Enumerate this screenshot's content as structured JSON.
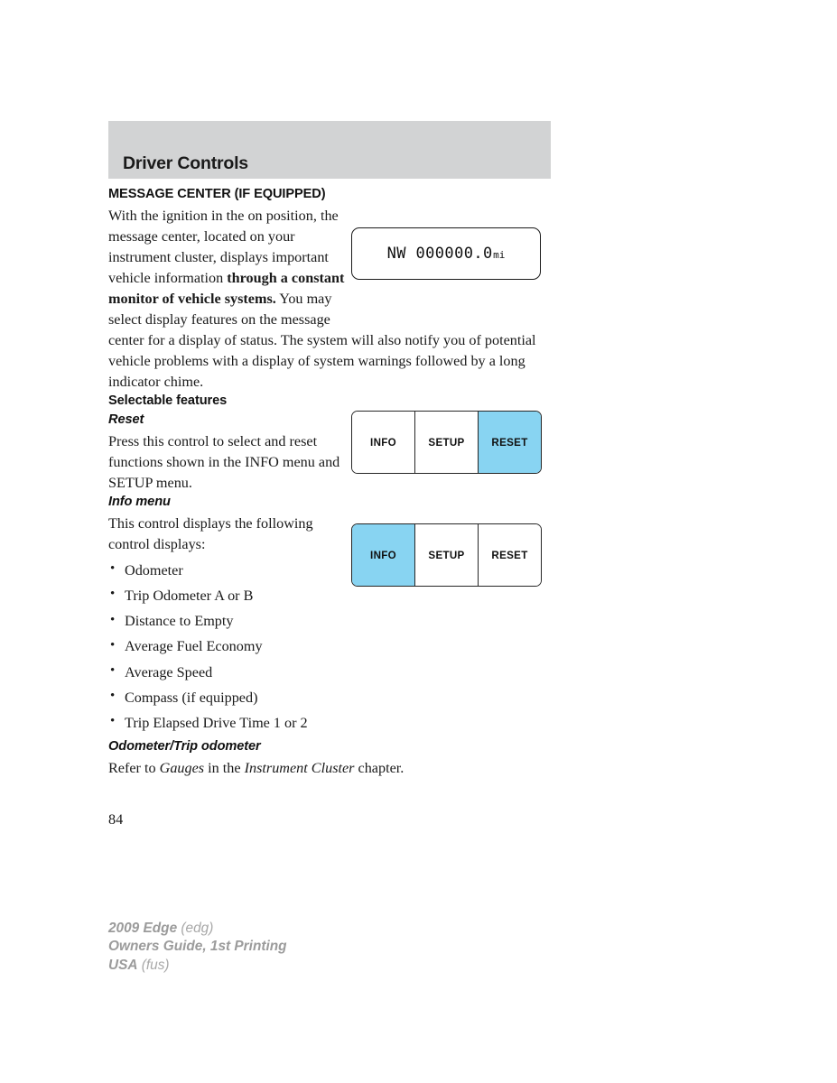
{
  "document": {
    "chapter_title": "Driver Controls",
    "page_number": "84"
  },
  "sections": {
    "message_center": {
      "heading": "MESSAGE CENTER (IF EQUIPPED)",
      "intro_part1": "With the ignition in the on position, the message center, located on your instrument cluster, displays important vehicle information ",
      "intro_bold": "through a constant monitor of vehicle systems.",
      "intro_part2": " You may select display features on the message center for a display of status. The system will also notify you of potential vehicle problems with a display of system warnings followed by a long indicator chime."
    },
    "selectable_features": {
      "heading": "Selectable features"
    },
    "reset": {
      "heading": "Reset",
      "body": "Press this control to select and reset functions shown in the INFO menu and SETUP menu."
    },
    "info_menu": {
      "heading": "Info menu",
      "body": "This control displays the following control displays:",
      "items": [
        "Odometer",
        "Trip Odometer A or B",
        "Distance to Empty",
        "Average Fuel Economy",
        "Average Speed",
        "Compass (if equipped)",
        "Trip Elapsed Drive Time 1 or 2"
      ]
    },
    "odometer": {
      "heading": "Odometer/Trip odometer",
      "body_part1": "Refer to ",
      "body_italic1": "Gauges",
      "body_part2": " in the ",
      "body_italic2": "Instrument Cluster",
      "body_part3": " chapter."
    }
  },
  "figures": {
    "lcd_display": {
      "value": "NW 000000.0",
      "unit": "mi"
    },
    "button_group_reset": {
      "buttons": [
        {
          "label": "INFO",
          "active": false
        },
        {
          "label": "SETUP",
          "active": false
        },
        {
          "label": "RESET",
          "active": true
        }
      ]
    },
    "button_group_info": {
      "buttons": [
        {
          "label": "INFO",
          "active": true
        },
        {
          "label": "SETUP",
          "active": false
        },
        {
          "label": "RESET",
          "active": false
        }
      ]
    }
  },
  "footer": {
    "line1_strong": "2009 Edge",
    "line1_light": " (edg)",
    "line2_strong": "Owners Guide, 1st Printing",
    "line3_strong": "USA",
    "line3_light": " (fus)"
  },
  "colors": {
    "header_band": "#d2d3d4",
    "highlight_blue": "#88d4f2",
    "footer_gray": "#9b9b9b"
  }
}
